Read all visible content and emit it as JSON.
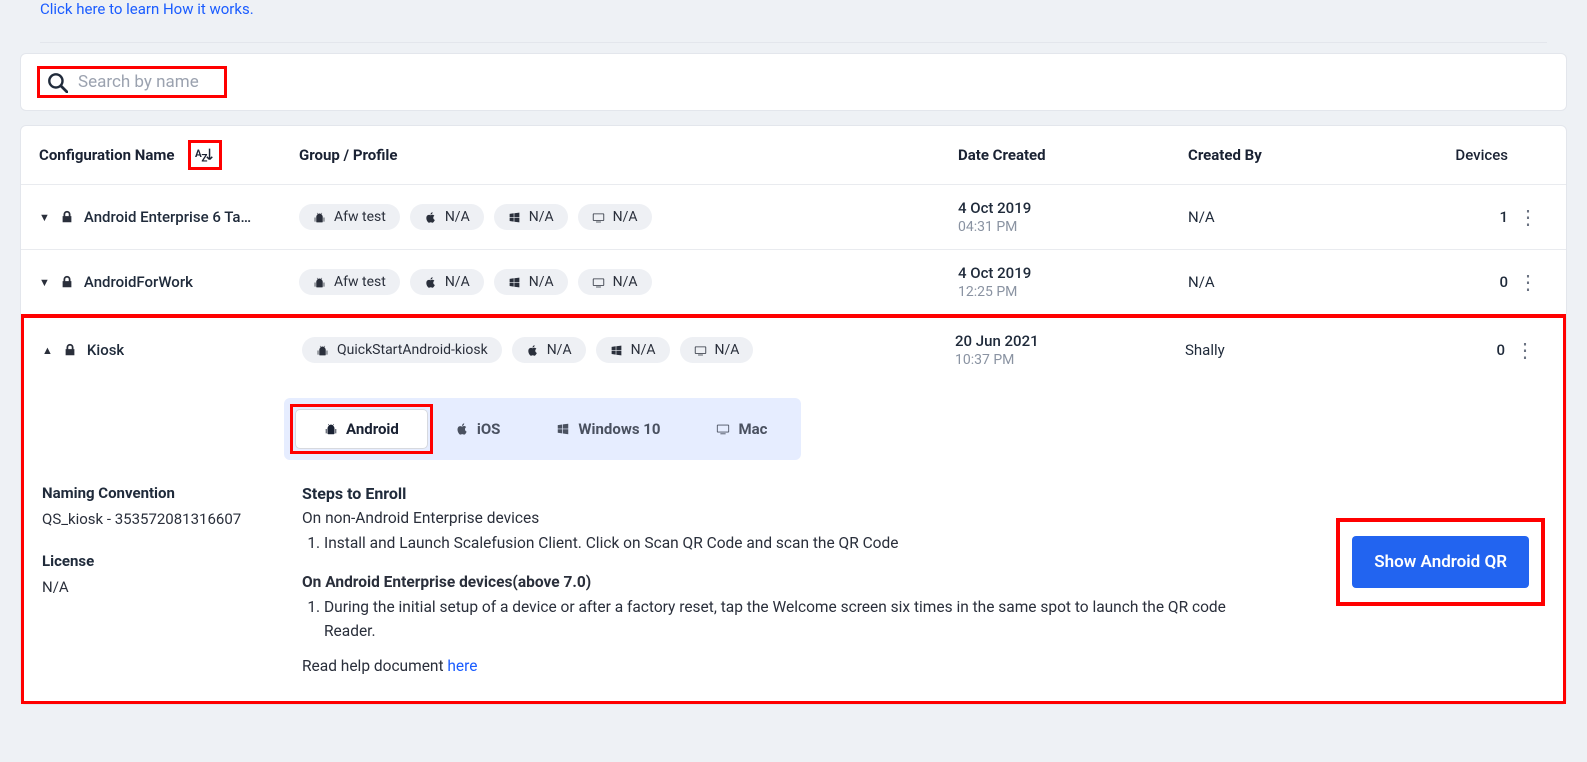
{
  "header": {
    "learn_link": "Click here to learn How it works."
  },
  "search": {
    "placeholder": "Search by name"
  },
  "table": {
    "headers": {
      "config": "Configuration Name",
      "group": "Group / Profile",
      "date": "Date Created",
      "created_by": "Created By",
      "devices": "Devices"
    },
    "rows": [
      {
        "expanded": false,
        "name": "Android Enterprise 6 Ta…",
        "chips": [
          {
            "icon": "android",
            "label": "Afw test"
          },
          {
            "icon": "apple",
            "label": "N/A"
          },
          {
            "icon": "windows",
            "label": "N/A"
          },
          {
            "icon": "mac",
            "label": "N/A"
          }
        ],
        "date": "4 Oct 2019",
        "time": "04:31 PM",
        "created_by": "N/A",
        "devices": "1"
      },
      {
        "expanded": false,
        "name": "AndroidForWork",
        "chips": [
          {
            "icon": "android",
            "label": "Afw test"
          },
          {
            "icon": "apple",
            "label": "N/A"
          },
          {
            "icon": "windows",
            "label": "N/A"
          },
          {
            "icon": "mac",
            "label": "N/A"
          }
        ],
        "date": "4 Oct 2019",
        "time": "12:25 PM",
        "created_by": "N/A",
        "devices": "0"
      },
      {
        "expanded": true,
        "name": "Kiosk",
        "chips": [
          {
            "icon": "android",
            "label": "QuickStartAndroid-kiosk"
          },
          {
            "icon": "apple",
            "label": "N/A"
          },
          {
            "icon": "windows",
            "label": "N/A"
          },
          {
            "icon": "mac",
            "label": "N/A"
          }
        ],
        "date": "20 Jun 2021",
        "time": "10:37 PM",
        "created_by": "Shally",
        "devices": "0"
      }
    ]
  },
  "os_tabs": {
    "android": "Android",
    "ios": "iOS",
    "windows": "Windows 10",
    "mac": "Mac"
  },
  "detail": {
    "naming_label": "Naming Convention",
    "naming_value": "QS_kiosk - 353572081316607",
    "license_label": "License",
    "license_value": "N/A",
    "steps_title": "Steps to Enroll",
    "steps_sub": "On non-Android Enterprise devices",
    "step1": "Install and Launch Scalefusion Client. Click on Scan QR Code and scan the QR Code",
    "ae_title": "On Android Enterprise devices(above 7.0)",
    "ae_step1": "During the initial setup of a device or after a factory reset, tap the Welcome screen six times in the same spot to launch the QR code Reader.",
    "help_prefix": "Read help document ",
    "help_link": "here",
    "qr_button": "Show Android QR"
  }
}
